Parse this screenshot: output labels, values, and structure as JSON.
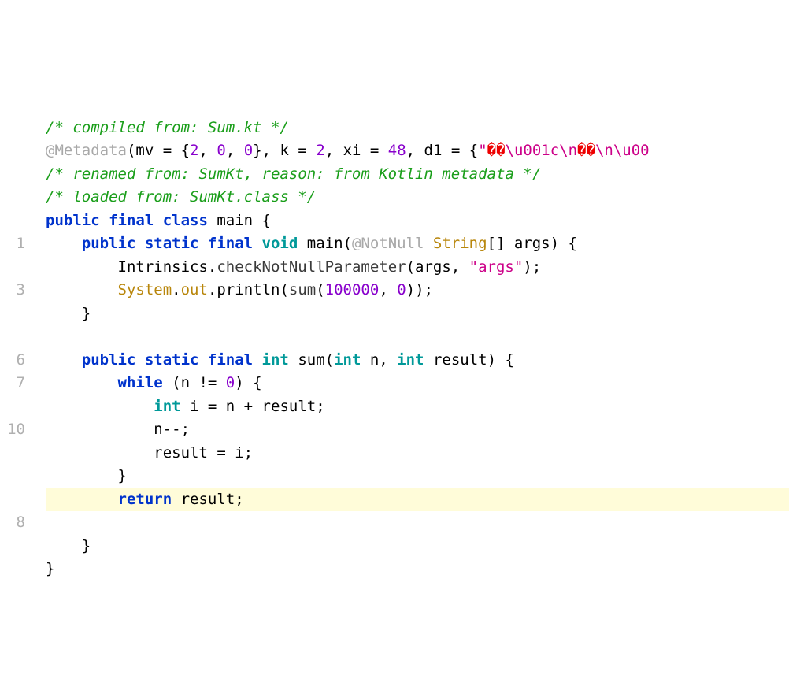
{
  "gutter": {
    "l1": "",
    "l2": "",
    "l3": "",
    "l4": "",
    "l5": "",
    "l6": "1",
    "l7": "",
    "l8": "3",
    "l9": "",
    "l10": "",
    "l11": "6",
    "l12": "7",
    "l13": "",
    "l14": "10",
    "l15": "",
    "l16": "",
    "l17": "",
    "l18": "8",
    "l19": "",
    "l20": ""
  },
  "code": {
    "c1": "/* compiled from: Sum.kt */",
    "c2_anno": "@Metadata",
    "c2_a": "(mv = {",
    "c2_n1": "2",
    "c2_n2": "0",
    "c2_n3": "0",
    "c2_b": "}, k = ",
    "c2_n4": "2",
    "c2_c": ", xi = ",
    "c2_n5": "48",
    "c2_d": ", d1 = {",
    "c2_s_open": "\"",
    "c2_s_red1": "��",
    "c2_s_mid1": "\\u001c\\n",
    "c2_s_red2": "��",
    "c2_s_mid2": "\\n\\u00",
    "c3": "/* renamed from: SumKt, reason: from Kotlin metadata */",
    "c4": "/* loaded from: SumKt.class */",
    "c5_kw": "public final class",
    "c5_name": " main {",
    "c6_kw1": "public static final ",
    "c6_void": "void",
    "c6_mname": " main(",
    "c6_anno": "@NotNull ",
    "c6_type": "String",
    "c6_rest": "[] args) {",
    "c7_a": "Intrinsics.",
    "c7_m": "checkNotNullParameter",
    "c7_b": "(args, ",
    "c7_s": "\"args\"",
    "c7_c": ");",
    "c8_a": "System",
    "c8_dot": ".",
    "c8_out": "out",
    "c8_b": ".println(",
    "c8_sum": "sum",
    "c8_c": "(",
    "c8_n1": "100000",
    "c8_comma": ", ",
    "c8_n2": "0",
    "c8_d": "));",
    "c9": "}",
    "c11_kw": "public static final ",
    "c11_int": "int",
    "c11_name": " sum(",
    "c11_int2": "int",
    "c11_p1": " n, ",
    "c11_int3": "int",
    "c11_p2": " result) {",
    "c12_kw": "while",
    "c12_rest": " (n != ",
    "c12_n": "0",
    "c12_b": ") {",
    "c13_kw": "int",
    "c13_rest": " i = n + result;",
    "c14": "n--;",
    "c15": "result = i;",
    "c16": "}",
    "c18_kw": "return",
    "c18_rest": " result;",
    "c19": "}",
    "c20": "}"
  }
}
